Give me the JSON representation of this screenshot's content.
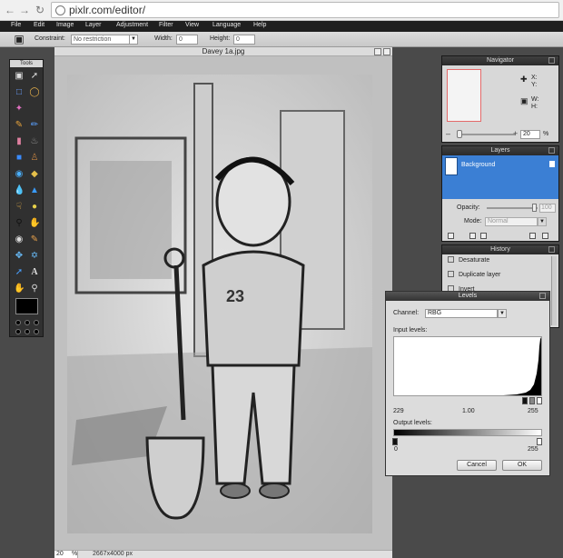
{
  "browser": {
    "url": "pixlr.com/editor/"
  },
  "menu": [
    "File",
    "Edit",
    "Image",
    "Layer",
    "Adjustment",
    "Filter",
    "View",
    "Language",
    "Help"
  ],
  "options": {
    "constraint_label": "Constraint:",
    "constraint_value": "No restriction",
    "width_label": "Width:",
    "width_value": "0",
    "height_label": "Height:",
    "height_value": "0"
  },
  "tools": {
    "title": "Tools",
    "items": [
      "crop-icon",
      "move-icon",
      "marquee-icon",
      "lasso-icon",
      "wand-icon",
      "pencil-icon",
      "brush-icon",
      "eraser-icon",
      "bucket-icon",
      "gradient-icon",
      "stamp-icon",
      "color-replace-icon",
      "drawing-icon",
      "blur-icon",
      "sharpen-icon",
      "smudge-icon",
      "sponge-icon",
      "dodge-icon",
      "burn-icon",
      "red-eye-icon",
      "spot-heal-icon",
      "bloat-icon",
      "pinch-icon",
      "clone-icon",
      "text-icon",
      "hand-icon",
      "zoom-icon"
    ]
  },
  "document": {
    "title": "Davey 1a.jpg",
    "zoom": "20",
    "zoom_unit": "%",
    "dimensions": "2667x4000 px"
  },
  "navigator": {
    "title": "Navigator",
    "x_label": "X:",
    "y_label": "Y:",
    "w_label": "W:",
    "h_label": "H:",
    "zoom": "20",
    "zoom_unit": "%"
  },
  "layers": {
    "title": "Layers",
    "items": [
      {
        "name": "Background",
        "selected": true
      }
    ],
    "opacity_label": "Opacity:",
    "opacity_value": "100",
    "mode_label": "Mode:",
    "mode_value": "Normal"
  },
  "history": {
    "title": "History",
    "items": [
      "Desaturate",
      "Duplicate layer",
      "Invert"
    ]
  },
  "levels": {
    "title": "Levels",
    "channel_label": "Channel:",
    "channel_value": "RBG",
    "input_label": "Input levels:",
    "input_black": "229",
    "input_gamma": "1.00",
    "input_white": "255",
    "output_label": "Output levels:",
    "output_black": "0",
    "output_white": "255",
    "cancel_label": "Cancel",
    "ok_label": "OK"
  },
  "colors": {
    "selected_layer": "#3b7fd4",
    "menubar": "#1f1f1f",
    "workspace": "#4a4a4a"
  }
}
